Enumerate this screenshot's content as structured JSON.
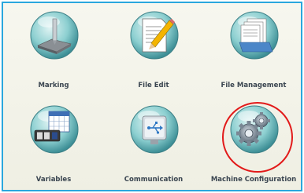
{
  "tiles": [
    {
      "label": "Marking",
      "icon": "marking-icon"
    },
    {
      "label": "File Edit",
      "icon": "file-edit-icon"
    },
    {
      "label": "File Management",
      "icon": "file-management-icon"
    },
    {
      "label": "Variables",
      "icon": "variables-icon"
    },
    {
      "label": "Communication",
      "icon": "communication-icon"
    },
    {
      "label": "Machine Configuration",
      "icon": "machine-configuration-icon"
    }
  ],
  "colors": {
    "frame_border": "#2aa7dd",
    "highlight_ring": "#e21a1a",
    "label_text": "#3a4550"
  },
  "variables_counter": "00"
}
